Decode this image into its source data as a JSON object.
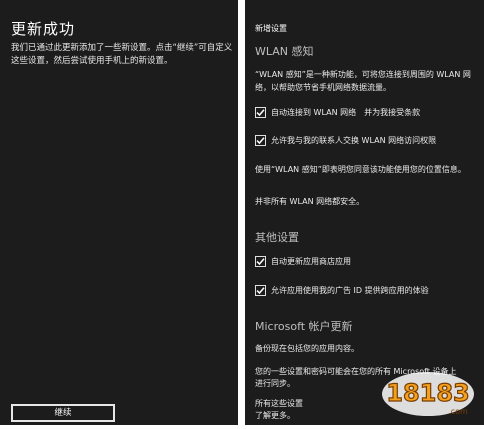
{
  "left": {
    "title": "更新成功",
    "body": "我们已通过此更新添加了一些新设置。点击“继续”可自定义这些设置，然后尝试使用手机上的新设置。",
    "continue_label": "继续"
  },
  "right": {
    "title": "新增设置",
    "wlan_heading": "WLAN 感知",
    "wlan_desc": "“WLAN 感知”是一种新功能，可将您连接到周围的 WLAN 网络，以帮助您节省手机网络数据流量。",
    "check1": "自动连接到 WLAN 网络　并为我接受条款",
    "check2": "允许我与我的联系人交换 WLAN 网络访问权限",
    "wlan_note": "使用“WLAN 感知”即表明您同意该功能使用您的位置信息。",
    "wlan_note2": "并非所有 WLAN 网络都安全。",
    "other_heading": "其他设置",
    "check3": "自动更新应用商店应用",
    "check4": "允许应用使用我的广告 ID 提供跨应用的体验",
    "ms_heading": "Microsoft 帐户更新",
    "backup_text": "备份现在包括您的应用内容。",
    "sync_text_1": "您的一些设置和密码可能会在您的所有 Microsoft 设备上",
    "sync_text_2": "进行同步。",
    "more_text_1": "所有这些设置",
    "more_text_2": "了解更多。"
  },
  "watermark": {
    "text": "18183",
    "sub": ".com"
  }
}
